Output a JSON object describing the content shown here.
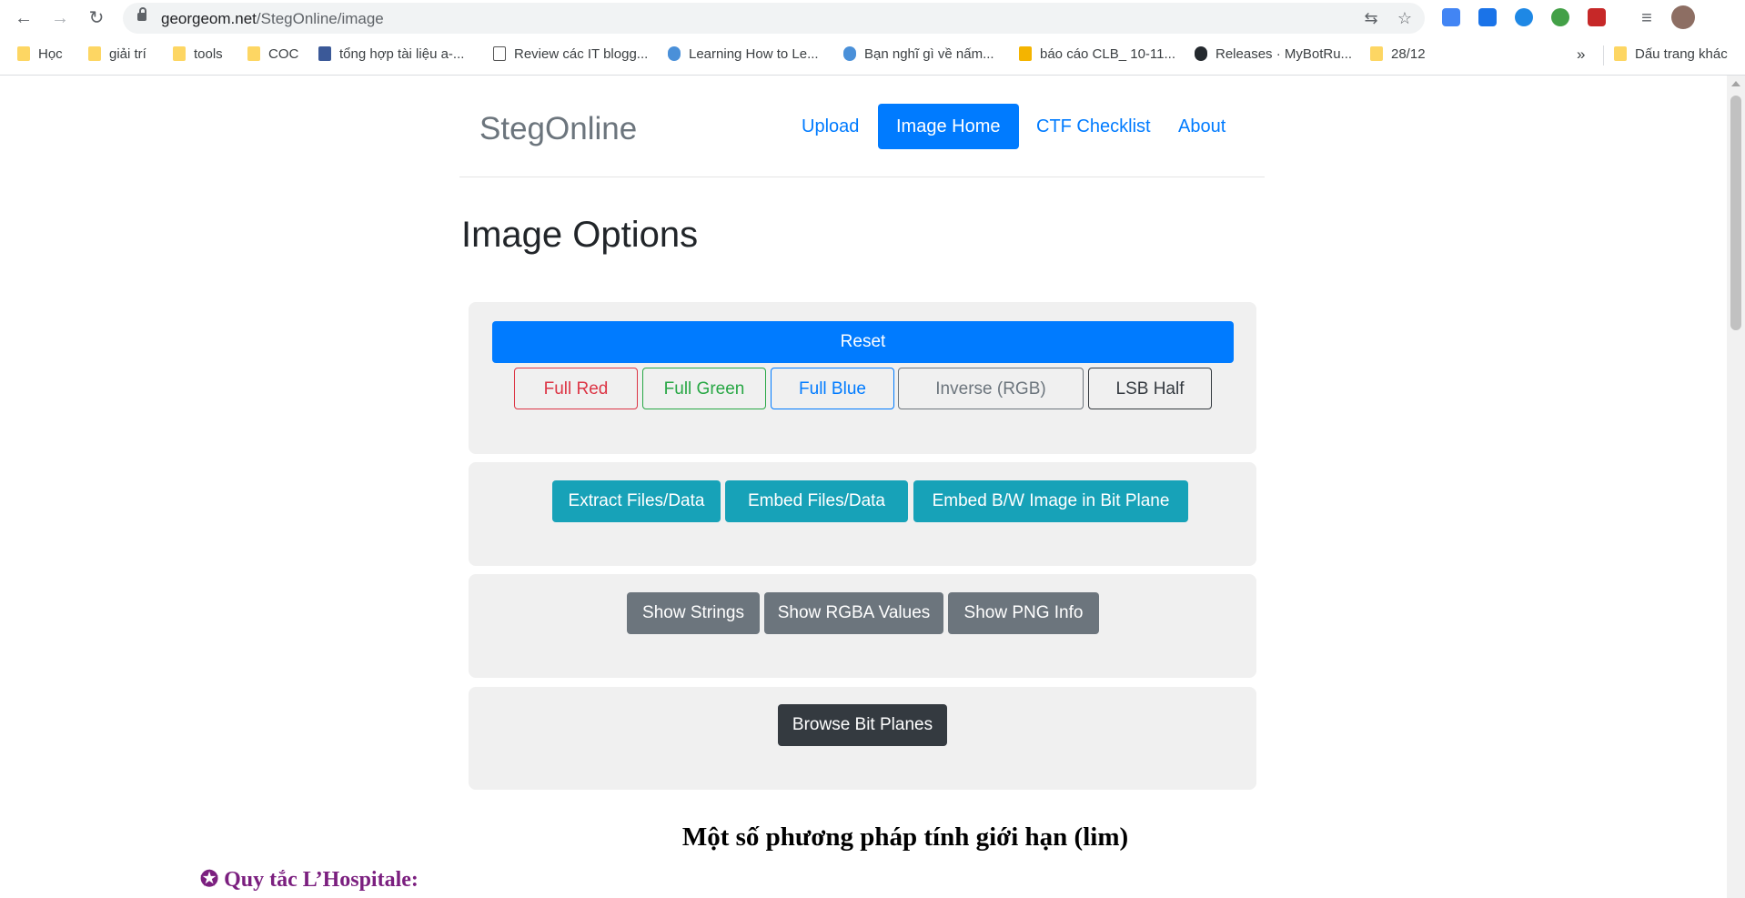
{
  "browser": {
    "url_host": "georgeom.net",
    "url_path": "/StegOnline/image",
    "bookmarks": [
      {
        "label": "Học",
        "icon": "folder-icon"
      },
      {
        "label": "giải trí",
        "icon": "folder-icon"
      },
      {
        "label": "tools",
        "icon": "folder-icon"
      },
      {
        "label": "COC",
        "icon": "folder-icon"
      },
      {
        "label": "tổng hợp tài liệu a-...",
        "icon": "facebook-icon"
      },
      {
        "label": "Review các IT blogg...",
        "icon": "code-icon"
      },
      {
        "label": "Learning How to Le...",
        "icon": "blue-owl-icon"
      },
      {
        "label": "Bạn nghĩ gì về nấm...",
        "icon": "blue-owl-icon"
      },
      {
        "label": "báo cáo CLB_ 10-11...",
        "icon": "slides-icon"
      },
      {
        "label": "Releases · MyBotRu...",
        "icon": "github-icon"
      },
      {
        "label": "28/12",
        "icon": "folder-icon"
      }
    ],
    "more_label": "»",
    "other_bookmarks": "Dấu trang khác"
  },
  "site": {
    "brand": "StegOnline",
    "nav": [
      {
        "label": "Upload",
        "active": false
      },
      {
        "label": "Image Home",
        "active": true
      },
      {
        "label": "CTF Checklist",
        "active": false
      },
      {
        "label": "About",
        "active": false
      }
    ]
  },
  "main": {
    "title": "Image Options",
    "reset": "Reset",
    "color_buttons": [
      "Full Red",
      "Full Green",
      "Full Blue",
      "Inverse (RGB)",
      "LSB Half"
    ],
    "data_buttons": [
      "Extract Files/Data",
      "Embed Files/Data",
      "Embed B/W Image in Bit Plane"
    ],
    "info_buttons": [
      "Show Strings",
      "Show RGBA Values",
      "Show PNG Info"
    ],
    "bitplane_button": "Browse Bit Planes"
  },
  "doc": {
    "title": "Một số phương pháp tính giới hạn (lim)",
    "rule_heading": "✪ Quy tắc L’Hospitale:"
  }
}
